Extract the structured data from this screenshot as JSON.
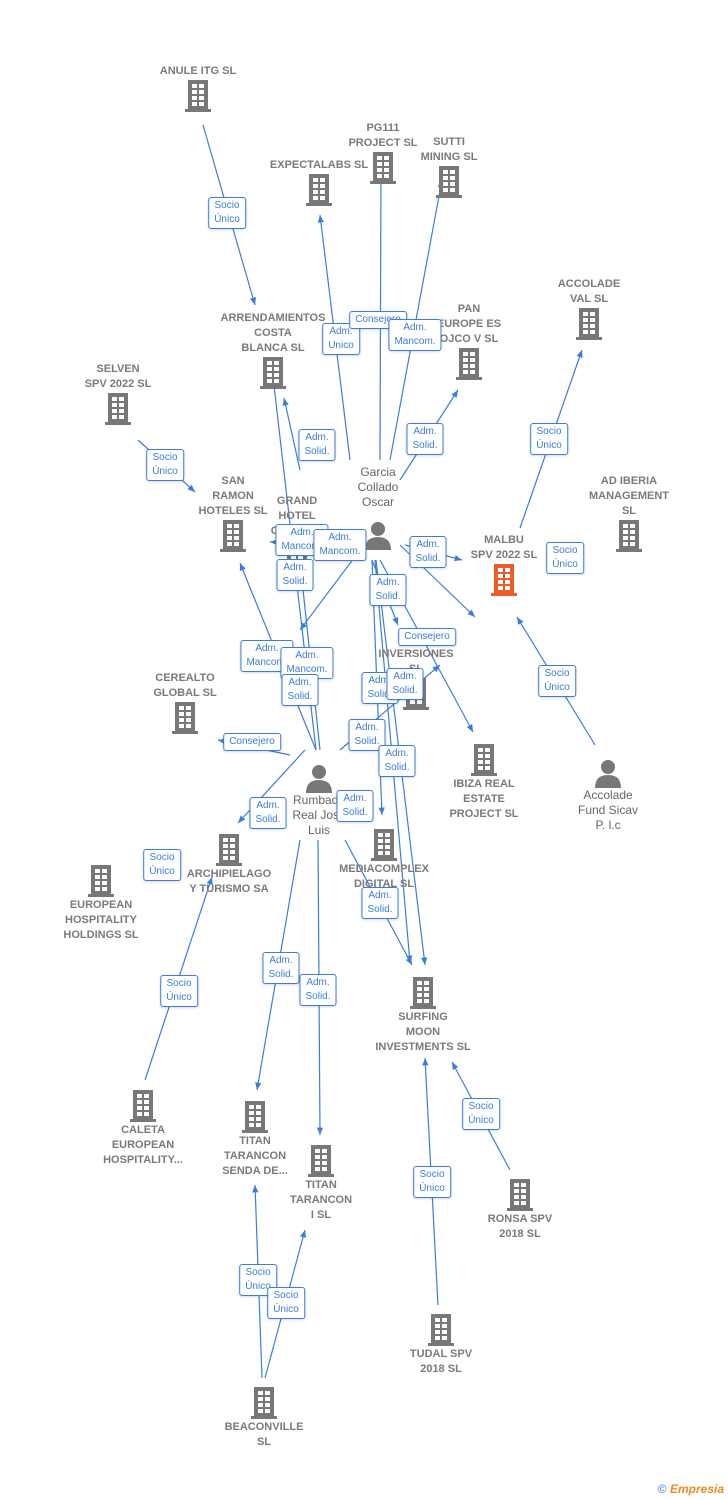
{
  "colors": {
    "edge": "#3b7ddd",
    "company": "#777777",
    "focus_company": "#f05a28",
    "person": "#777777"
  },
  "companies": [
    {
      "label": "ANULE ITG  SL"
    },
    {
      "label": "PG111\nPROJECT  SL"
    },
    {
      "label": "SUTTI\nMINING SL"
    },
    {
      "label": "EXPECTALABS SL"
    },
    {
      "label": "ACCOLADE\nVAL  SL"
    },
    {
      "label": "ARRENDAMIENTOS\nCOSTA\nBLANCA SL"
    },
    {
      "label": "PAN\nEUROPE ES\nOJCO V SL"
    },
    {
      "label": "SELVEN\nSPV 2022  SL"
    },
    {
      "label": "SAN\nRAMON\nHOTELES SL"
    },
    {
      "label": "GRAND\nHOTEL\nCENTRAL"
    },
    {
      "label": "AD IBERIA\nMANAGEMENT\nSL"
    },
    {
      "label": "MALBU\nSPV 2022  SL",
      "focus": true
    },
    {
      "label": "A...\nINVERSIONES\nSL"
    },
    {
      "label": "CEREALTO\nGLOBAL  SL"
    },
    {
      "label": "IBIZA REAL\nESTATE\nPROJECT  SL"
    },
    {
      "label": "ARCHIPIELAGO\nY TURISMO SA"
    },
    {
      "label": "EUROPEAN\nHOSPITALITY\nHOLDINGS  SL"
    },
    {
      "label": "MEDIACOMPLEX\nDIGITAL SL"
    },
    {
      "label": "SURFING\nMOON\nINVESTMENTS SL"
    },
    {
      "label": "CALETA\nEUROPEAN\nHOSPITALITY..."
    },
    {
      "label": "TITAN\nTARANCON\nSENDA DE..."
    },
    {
      "label": "TITAN\nTARANCON\nI  SL"
    },
    {
      "label": "RONSA SPV\n2018  SL"
    },
    {
      "label": "TUDAL SPV\n2018  SL"
    },
    {
      "label": "BEACONVILLE\nSL"
    }
  ],
  "persons": [
    {
      "label": "Garcia\nCollado\nOscar"
    },
    {
      "label": "Rumbado\nReal Jose\nLuis"
    },
    {
      "label": "Accolade\nFund Sicav\nP. l.c"
    }
  ],
  "edge_labels": [
    "Socio\nÚnico",
    "Adm.\nUnico",
    "Consejero",
    "Adm.\nMancom.",
    "Adm.\nSolid.",
    "Adm.\nSolid.",
    "Socio\nÚnico",
    "Socio\nÚnico",
    "Adm.\nMancom.",
    "Adm.\nMancom.",
    "Adm.\nSolid.",
    "Adm.\nSolid.",
    "Socio\nÚnico",
    "Adm.\nSolid.",
    "Consejero",
    "Adm.\nMancom.",
    "Adm.\nMancom.",
    "Adm.\nSolid.",
    "Adm.\nSolid.",
    "Adm.\nSolid.",
    "Socio\nÚnico",
    "Consejero",
    "Adm.\nSolid.",
    "Adm.\nSolid.",
    "Adm.\nSolid.",
    "Adm.\nSolid.",
    "Socio\nÚnico",
    "Adm.\nSolid.",
    "Adm.\nSolid.",
    "Adm.\nSolid.",
    "Socio\nÚnico",
    "Socio\nÚnico",
    "Socio\nÚnico",
    "Socio\nÚnico",
    "Socio\nÚnico"
  ],
  "footer": {
    "copyright": "©",
    "brand": "Empresia"
  }
}
